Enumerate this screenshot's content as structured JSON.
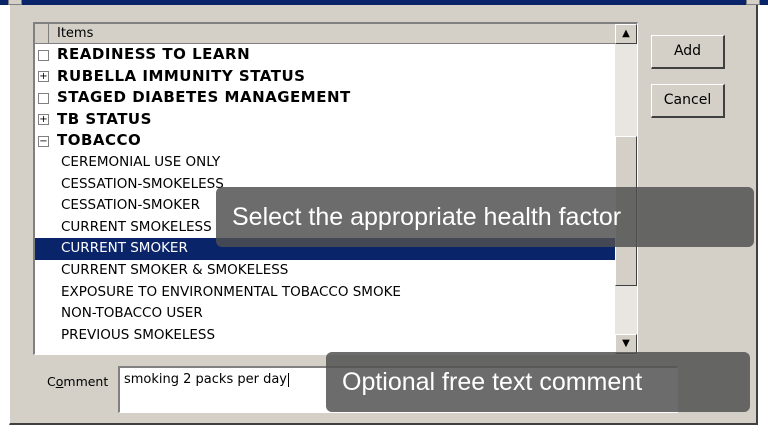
{
  "list": {
    "header": "Items",
    "items": [
      {
        "label": "READINESS TO LEARN",
        "kind": "group",
        "expander": ""
      },
      {
        "label": "RUBELLA IMMUNITY STATUS",
        "kind": "group",
        "expander": "+"
      },
      {
        "label": "STAGED DIABETES MANAGEMENT",
        "kind": "group",
        "expander": ""
      },
      {
        "label": "TB STATUS",
        "kind": "group",
        "expander": "+"
      },
      {
        "label": "TOBACCO",
        "kind": "group",
        "expander": "−"
      },
      {
        "label": "CEREMONIAL USE ONLY",
        "kind": "child"
      },
      {
        "label": "CESSATION-SMOKELESS",
        "kind": "child"
      },
      {
        "label": "CESSATION-SMOKER",
        "kind": "child"
      },
      {
        "label": "CURRENT SMOKELESS",
        "kind": "child"
      },
      {
        "label": "CURRENT SMOKER",
        "kind": "child",
        "selected": true
      },
      {
        "label": "CURRENT SMOKER & SMOKELESS",
        "kind": "child"
      },
      {
        "label": "EXPOSURE TO ENVIRONMENTAL TOBACCO SMOKE",
        "kind": "child"
      },
      {
        "label": "NON-TOBACCO USER",
        "kind": "child"
      },
      {
        "label": "PREVIOUS SMOKELESS",
        "kind": "child"
      }
    ]
  },
  "buttons": {
    "add": "Add",
    "cancel": "Cancel"
  },
  "comment": {
    "label_prefix": "C",
    "label_mnemonic": "o",
    "label_rest": "mment",
    "value": "smoking 2 packs per day"
  },
  "overlays": {
    "health_factor": "Select the appropriate health factor",
    "comment": "Optional free text comment"
  },
  "colors": {
    "selection": "#0a246a",
    "dialog": "#d4d0c8",
    "overlay": "#505050"
  },
  "icons": {
    "scroll_up": "triangle-up-icon",
    "scroll_down": "triangle-down-icon"
  }
}
